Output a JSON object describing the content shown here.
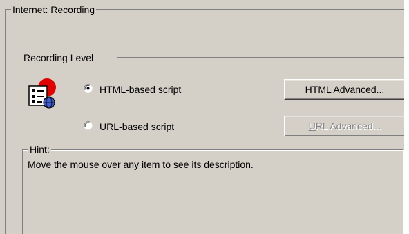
{
  "window": {
    "group_title": "Internet: Recording"
  },
  "recording_level": {
    "label": "Recording Level",
    "icon": "recording-script-icon",
    "options": [
      {
        "label_pre": "HT",
        "mnemonic": "M",
        "label_post": "L-based script",
        "selected": true
      },
      {
        "label_pre": "U",
        "mnemonic": "R",
        "label_post": "L-based script",
        "selected": false
      }
    ],
    "html_advanced_pre": "",
    "html_advanced_mnemonic": "H",
    "html_advanced_post": "TML Advanced...",
    "url_advanced_pre": "",
    "url_advanced_mnemonic": "U",
    "url_advanced_post": "RL Advanced...",
    "url_advanced_enabled": false
  },
  "hint": {
    "title": "Hint:",
    "text": "Move the mouse over any item to see its description."
  },
  "colors": {
    "face": "#d4d0c8",
    "shadow": "#808080",
    "highlight": "#ffffff",
    "disabled_text": "#808080"
  }
}
